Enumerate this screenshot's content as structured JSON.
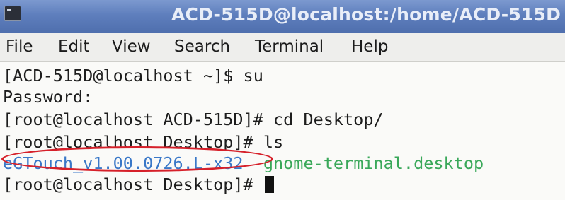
{
  "window": {
    "title": "ACD-515D@localhost:/home/ACD-515D"
  },
  "menu": {
    "items": [
      "File",
      "Edit",
      "View",
      "Search",
      "Terminal",
      "Help"
    ]
  },
  "terminal": {
    "lines": [
      {
        "text": "[ACD-515D@localhost ~]$ su"
      },
      {
        "text": "Password:"
      },
      {
        "text": "[root@localhost ACD-515D]# cd Desktop/"
      },
      {
        "text": "[root@localhost Desktop]# ls"
      },
      {
        "file1": "eGTouch_v1.00.0726.L-x32",
        "file2": "gnome-terminal.desktop"
      },
      {
        "text": "[root@localhost Desktop]# "
      }
    ]
  },
  "colors": {
    "titlebar": "#5f7fbd",
    "directory_listing": "#3a78c8",
    "desktop_file": "#3aa85a",
    "highlight": "#d6202a"
  },
  "icons": {
    "app": "terminal-icon"
  }
}
